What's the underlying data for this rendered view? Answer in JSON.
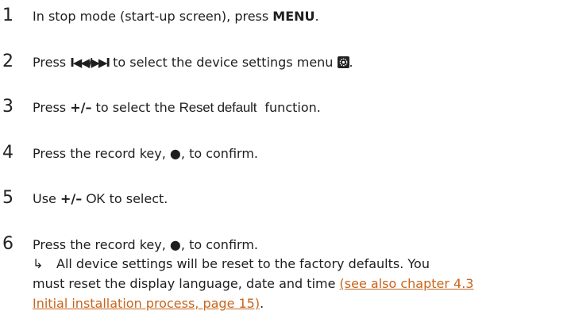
{
  "steps": [
    {
      "number": "1",
      "pre": "In stop mode (start-up screen), press ",
      "bold": "MENU",
      "post": "."
    },
    {
      "number": "2",
      "pre": "Press ",
      "nav_glyph": "I◀◀/▶▶I",
      "mid": " to select the device settings menu ",
      "icon": "settings-icon",
      "post": "."
    },
    {
      "number": "3",
      "pre": "Press ",
      "bold": "+/–",
      "mid": " to select the ",
      "function_name": "Reset default",
      "post": "  function."
    },
    {
      "number": "4",
      "pre": "Press the record key, ",
      "record_glyph": "●",
      "post": ", to confirm."
    },
    {
      "number": "5",
      "pre": "Use ",
      "bold": "+/–",
      "mid": " ",
      "option": "OK",
      "post": " to select."
    },
    {
      "number": "6",
      "pre": "Press the record key, ",
      "record_glyph": "●",
      "post": ", to confirm.",
      "result_arrow": "↳",
      "result_line1": "All device settings will be reset to the factory defaults. You",
      "result_line2_pre": "must reset the display language, date and time ",
      "link_part1": "(see also chapter 4.3",
      "link_part2": "Initial installation process, page 15)",
      "result_end": "."
    }
  ]
}
